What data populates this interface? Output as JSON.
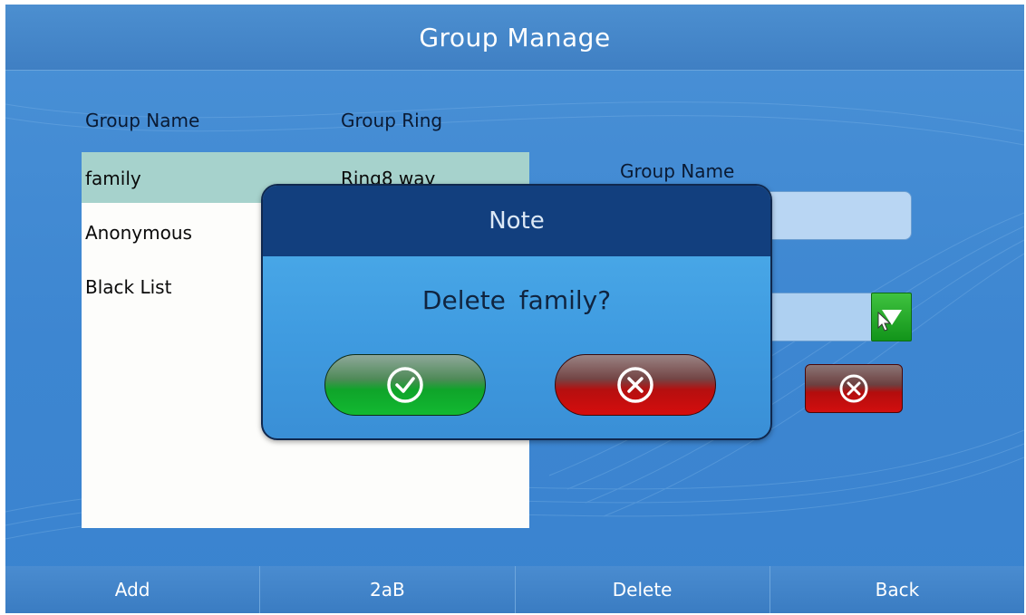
{
  "title": "Group Manage",
  "list": {
    "headers": [
      "Group Name",
      "Group Ring"
    ],
    "rows": [
      {
        "name": "family",
        "ring": "Ring8 way",
        "selected": true
      },
      {
        "name": "Anonymous",
        "ring": ""
      },
      {
        "name": "Black List",
        "ring": ""
      }
    ]
  },
  "edit_panel": {
    "group_name_label": "Group Name",
    "icons": {
      "dropdown": "triangle-down-icon",
      "cancel": "circle-x-icon"
    }
  },
  "dialog": {
    "title": "Note",
    "message": "Delete  family?",
    "icons": {
      "confirm": "circle-check-icon",
      "cancel": "circle-x-icon"
    }
  },
  "softkeys": [
    "Add",
    "2aB",
    "Delete",
    "Back"
  ],
  "colors": {
    "background": "#3d86d1",
    "title_bar": "#4585c9",
    "dialog_header": "#123f7e",
    "selected_row": "#a6d2cc",
    "confirm_green": "#12b931",
    "cancel_red": "#d20f0f"
  }
}
